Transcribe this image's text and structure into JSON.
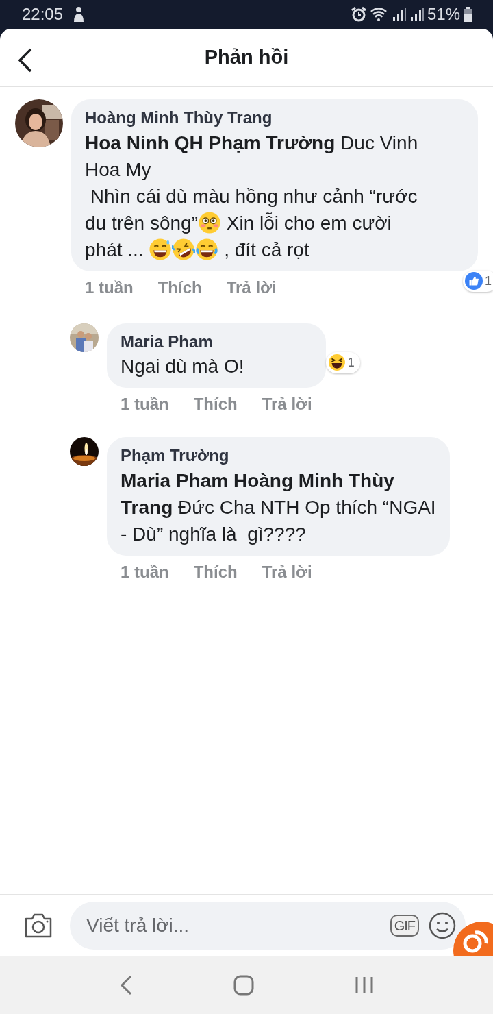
{
  "status_bar": {
    "time": "22:05",
    "battery": "51%"
  },
  "header": {
    "title": "Phản hồi"
  },
  "comments": [
    {
      "author": "Hoàng Minh Thùy Trang",
      "lines": [
        [
          {
            "kind": "text",
            "text": "**Hoa Ninh QH Phạm Trường** Duc Vinh"
          }
        ],
        [
          {
            "kind": "text",
            "text": "Hoa My"
          }
        ],
        [
          {
            "kind": "text",
            "text": " Nhìn cái dù màu hồng như cảnh “rước"
          }
        ],
        [
          {
            "kind": "text",
            "text": "du trên sông”"
          },
          {
            "kind": "flushed"
          },
          {
            "kind": "text",
            "text": " Xin lỗi cho em cười"
          }
        ],
        [
          {
            "kind": "text",
            "text": "phát ... "
          },
          {
            "kind": "grin-sweat"
          },
          {
            "kind": "rofl"
          },
          {
            "kind": "joy"
          },
          {
            "kind": "text",
            "text": " , đít cả rọt"
          }
        ]
      ],
      "time": "1 tuần",
      "like": "Thích",
      "reply": "Trả lời",
      "reaction": {
        "kind": "like",
        "count": "1"
      },
      "replies": [
        {
          "author": "Maria Pham",
          "lines": [
            [
              {
                "kind": "text",
                "text": "Ngai dù mà O!"
              }
            ]
          ],
          "time": "1 tuần",
          "like": "Thích",
          "reply": "Trả lời",
          "reaction": {
            "kind": "haha",
            "count": "1"
          }
        },
        {
          "author": "Phạm Trường",
          "lines": [
            [
              {
                "kind": "text",
                "text": "**Maria Pham Hoàng Minh Thùy**"
              }
            ],
            [
              {
                "kind": "text",
                "text": "**Trang** Đức Cha NTH Op thích “NGAI"
              }
            ],
            [
              {
                "kind": "text",
                "text": "- Dù” nghĩa là  gì????"
              }
            ]
          ],
          "time": "1 tuần",
          "like": "Thích",
          "reply": "Trả lời"
        }
      ]
    }
  ],
  "composer": {
    "placeholder": "Viết trả lời...",
    "gif": "GIF"
  }
}
